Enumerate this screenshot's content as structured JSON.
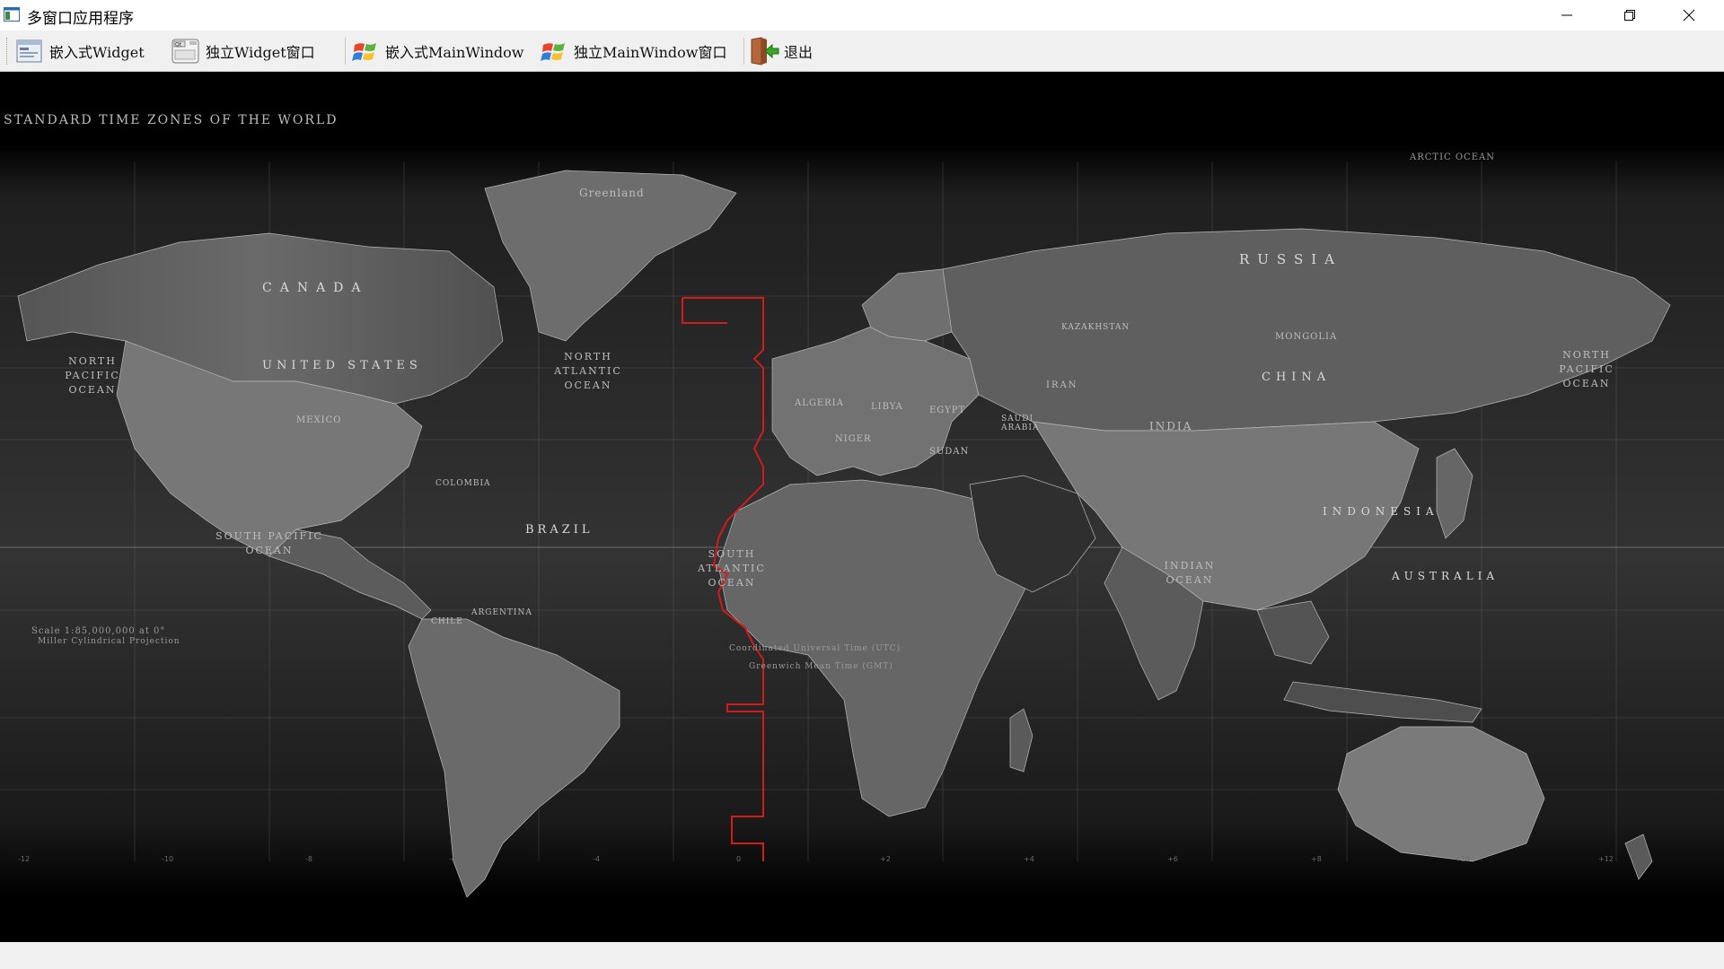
{
  "window": {
    "title": "多窗口应用程序",
    "icon": "app-window-icon",
    "controls": {
      "minimize": "minimize-icon",
      "maximize": "restore-icon",
      "close": "close-icon"
    }
  },
  "toolbar": {
    "buttons": [
      {
        "label": "嵌入式Widget",
        "icon": "embedded-widget-icon"
      },
      {
        "label": "独立Widget窗口",
        "icon": "qt-window-icon"
      },
      {
        "label": "嵌入式MainWindow",
        "icon": "windows-flag-icon"
      },
      {
        "label": "独立MainWindow窗口",
        "icon": "windows-flag-icon"
      },
      {
        "label": "退出",
        "icon": "exit-door-icon"
      }
    ]
  },
  "map": {
    "title": "STANDARD TIME ZONES OF THE WORLD",
    "labels": {
      "russia": "RUSSIA",
      "canada": "CANADA",
      "united_states": "UNITED STATES",
      "china": "CHINA",
      "brazil": "BRAZIL",
      "australia": "AUSTRALIA",
      "indonesia": "INDONESIA",
      "india": "INDIA",
      "mongolia": "MONGOLIA",
      "kazakhstan": "KAZAKHSTAN",
      "greenland": "Greenland",
      "algeria": "ALGERIA",
      "libya": "LIBYA",
      "egypt": "EGYPT",
      "sudan": "SUDAN",
      "niger": "NIGER",
      "saudi_arabia": "SAUDI ARABIA",
      "iran": "IRAN",
      "mexico": "MEXICO",
      "colombia": "COLOMBIA",
      "argentina": "ARGENTINA",
      "chile": "CHILE",
      "north_pacific": "NORTH PACIFIC OCEAN",
      "south_pacific": "SOUTH PACIFIC OCEAN",
      "north_atlantic": "NORTH ATLANTIC OCEAN",
      "south_atlantic": "SOUTH ATLANTIC OCEAN",
      "indian_ocean": "INDIAN OCEAN",
      "arctic_ocean": "ARCTIC OCEAN",
      "scale": "Scale 1:85,000,000 at 0°",
      "projection": "Miller Cylindrical Projection",
      "utc_note": "Coordinated Universal Time (UTC)",
      "gmt_note": "Greenwich Mean Time (GMT)"
    },
    "colors": {
      "background": "#000000",
      "land": "#5a5a5a",
      "grid": "#8a8a8a",
      "utc_line": "#d01c1c"
    }
  }
}
